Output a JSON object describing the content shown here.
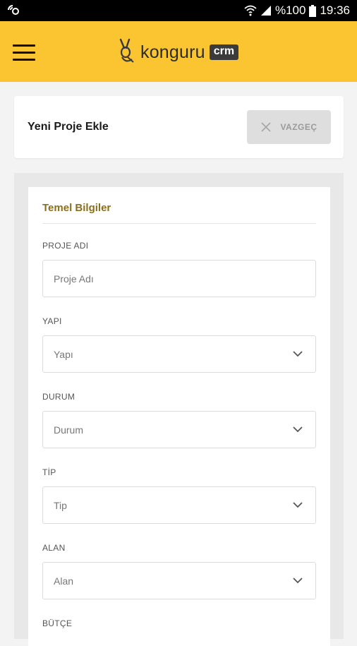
{
  "status_bar": {
    "left_icon": "nfc-icon",
    "percent": "%100",
    "time": "19:36"
  },
  "app_bar": {
    "brand": "konguru",
    "brand_badge": "crm",
    "accent_color": "#fac531"
  },
  "header": {
    "title": "Yeni Proje Ekle",
    "cancel_label": "VAZGEÇ"
  },
  "form": {
    "section_title": "Temel Bilgiler",
    "fields": [
      {
        "label": "PROJE ADI",
        "placeholder": "Proje Adı",
        "type": "text"
      },
      {
        "label": "YAPI",
        "placeholder": "Yapı",
        "type": "select"
      },
      {
        "label": "DURUM",
        "placeholder": "Durum",
        "type": "select"
      },
      {
        "label": "TİP",
        "placeholder": "Tip",
        "type": "select"
      },
      {
        "label": "ALAN",
        "placeholder": "Alan",
        "type": "select"
      },
      {
        "label": "BÜTÇE"
      }
    ]
  }
}
